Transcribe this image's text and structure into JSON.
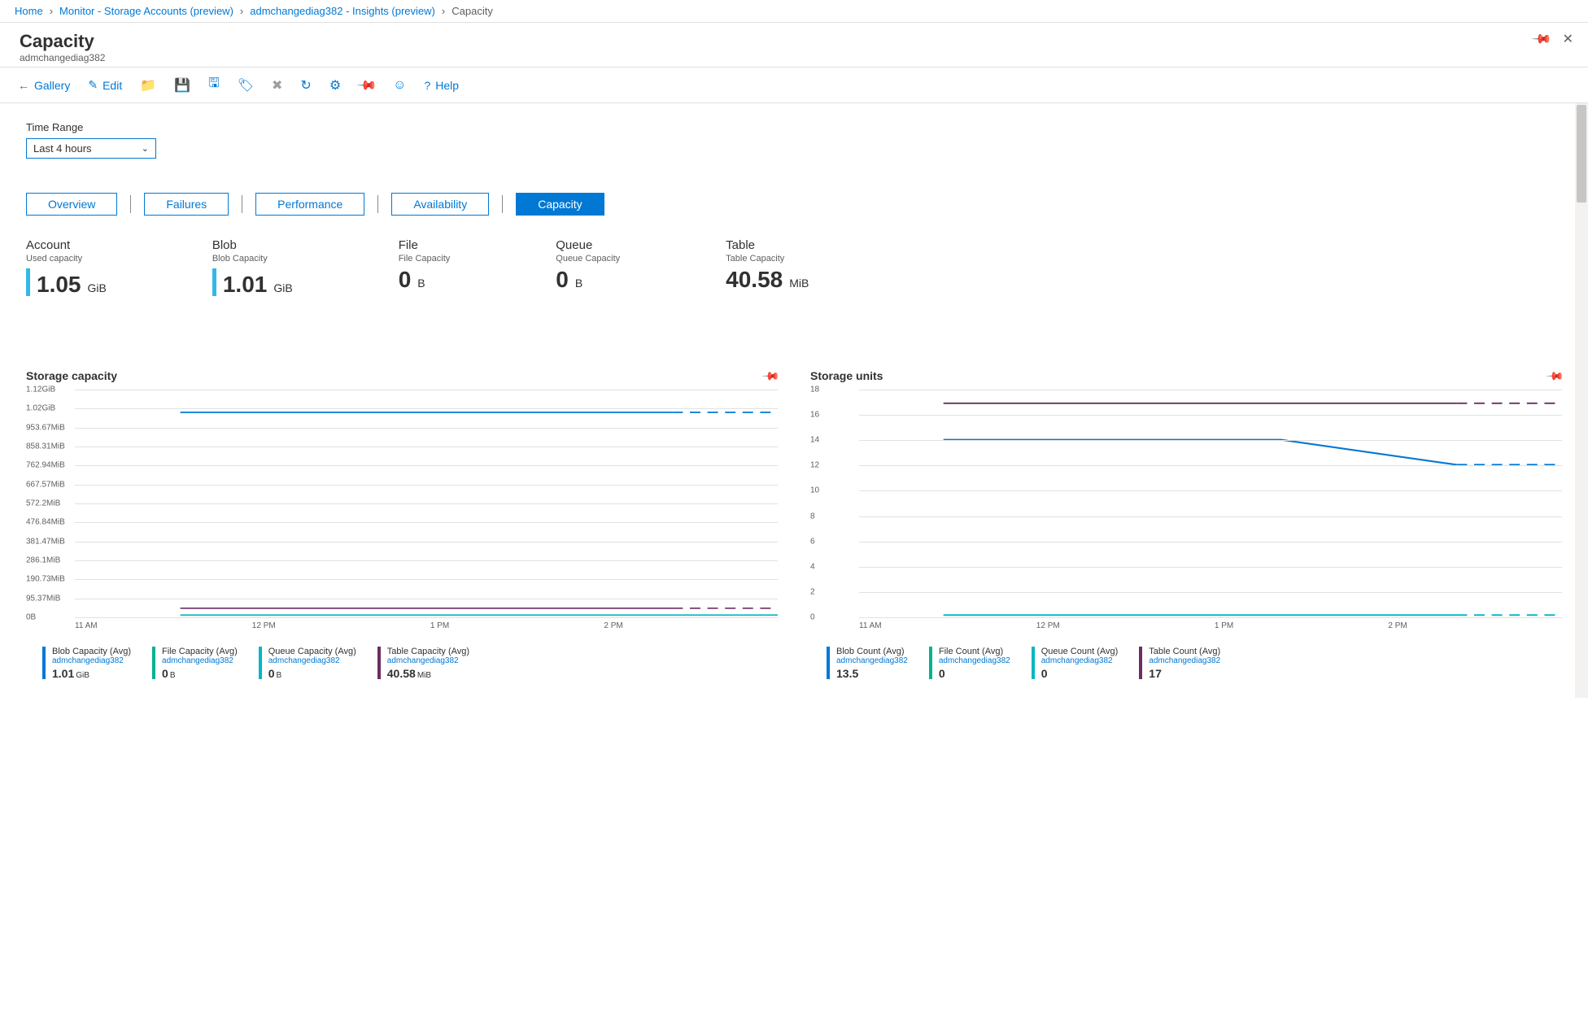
{
  "breadcrumb": {
    "home": "Home",
    "monitor": "Monitor - Storage Accounts (preview)",
    "insights": "admchangediag382 - Insights (preview)",
    "current": "Capacity"
  },
  "header": {
    "title": "Capacity",
    "subtitle": "admchangediag382"
  },
  "toolbar": {
    "gallery": "Gallery",
    "edit": "Edit",
    "help": "Help"
  },
  "timeRange": {
    "label": "Time Range",
    "value": "Last 4 hours"
  },
  "tabs": {
    "overview": "Overview",
    "failures": "Failures",
    "performance": "Performance",
    "availability": "Availability",
    "capacity": "Capacity"
  },
  "stats": {
    "account": {
      "title": "Account",
      "sub": "Used capacity",
      "val": "1.05",
      "unit": "GiB",
      "hasBar": true
    },
    "blob": {
      "title": "Blob",
      "sub": "Blob Capacity",
      "val": "1.01",
      "unit": "GiB",
      "hasBar": true
    },
    "file": {
      "title": "File",
      "sub": "File Capacity",
      "val": "0",
      "unit": "B",
      "hasBar": false
    },
    "queue": {
      "title": "Queue",
      "sub": "Queue Capacity",
      "val": "0",
      "unit": "B",
      "hasBar": false
    },
    "table": {
      "title": "Table",
      "sub": "Table Capacity",
      "val": "40.58",
      "unit": "MiB",
      "hasBar": false
    }
  },
  "charts": {
    "capacity": {
      "title": "Storage capacity",
      "yticks": [
        "1.12GiB",
        "1.02GiB",
        "953.67MiB",
        "858.31MiB",
        "762.94MiB",
        "667.57MiB",
        "572.2MiB",
        "476.84MiB",
        "381.47MiB",
        "286.1MiB",
        "190.73MiB",
        "95.37MiB",
        "0B"
      ],
      "xticks": [
        "11 AM",
        "12 PM",
        "1 PM",
        "2 PM"
      ],
      "legend": [
        {
          "color": "#0078d4",
          "title": "Blob Capacity (Avg)",
          "sub": "admchangediag382",
          "val": "1.01",
          "unit": "GiB"
        },
        {
          "color": "#00B294",
          "title": "File Capacity (Avg)",
          "sub": "admchangediag382",
          "val": "0",
          "unit": "B"
        },
        {
          "color": "#00B7C3",
          "title": "Queue Capacity (Avg)",
          "sub": "admchangediag382",
          "val": "0",
          "unit": "B"
        },
        {
          "color": "#6B2E5F",
          "title": "Table Capacity (Avg)",
          "sub": "admchangediag382",
          "val": "40.58",
          "unit": "MiB"
        }
      ]
    },
    "units": {
      "title": "Storage units",
      "yticks": [
        "18",
        "16",
        "14",
        "12",
        "10",
        "8",
        "6",
        "4",
        "2",
        "0"
      ],
      "xticks": [
        "11 AM",
        "12 PM",
        "1 PM",
        "2 PM"
      ],
      "legend": [
        {
          "color": "#0078d4",
          "title": "Blob Count (Avg)",
          "sub": "admchangediag382",
          "val": "13.5",
          "unit": ""
        },
        {
          "color": "#00B294",
          "title": "File Count (Avg)",
          "sub": "admchangediag382",
          "val": "0",
          "unit": ""
        },
        {
          "color": "#00B7C3",
          "title": "Queue Count (Avg)",
          "sub": "admchangediag382",
          "val": "0",
          "unit": ""
        },
        {
          "color": "#6B2E5F",
          "title": "Table Count (Avg)",
          "sub": "admchangediag382",
          "val": "17",
          "unit": ""
        }
      ]
    }
  },
  "chart_data": [
    {
      "type": "line",
      "title": "Storage capacity",
      "xlabel": "",
      "ylabel": "",
      "x": [
        "11 AM",
        "12 PM",
        "1 PM",
        "2 PM"
      ],
      "ylim_bytes": [
        0,
        1202590842
      ],
      "series": [
        {
          "name": "Blob Capacity (Avg)",
          "unit": "GiB",
          "values": [
            1.01,
            1.01,
            1.01,
            1.01
          ]
        },
        {
          "name": "File Capacity (Avg)",
          "unit": "B",
          "values": [
            0,
            0,
            0,
            0
          ]
        },
        {
          "name": "Queue Capacity (Avg)",
          "unit": "B",
          "values": [
            0,
            0,
            0,
            0
          ]
        },
        {
          "name": "Table Capacity (Avg)",
          "unit": "MiB",
          "values": [
            40.58,
            40.58,
            40.58,
            40.58
          ]
        }
      ]
    },
    {
      "type": "line",
      "title": "Storage units",
      "xlabel": "",
      "ylabel": "",
      "x": [
        "11 AM",
        "12 PM",
        "1 PM",
        "2 PM"
      ],
      "ylim": [
        0,
        18
      ],
      "series": [
        {
          "name": "Blob Count (Avg)",
          "values": [
            14,
            14,
            14,
            12
          ]
        },
        {
          "name": "File Count (Avg)",
          "values": [
            0,
            0,
            0,
            0
          ]
        },
        {
          "name": "Queue Count (Avg)",
          "values": [
            0,
            0,
            0,
            0
          ]
        },
        {
          "name": "Table Count (Avg)",
          "values": [
            17,
            17,
            17,
            17
          ]
        }
      ]
    }
  ]
}
